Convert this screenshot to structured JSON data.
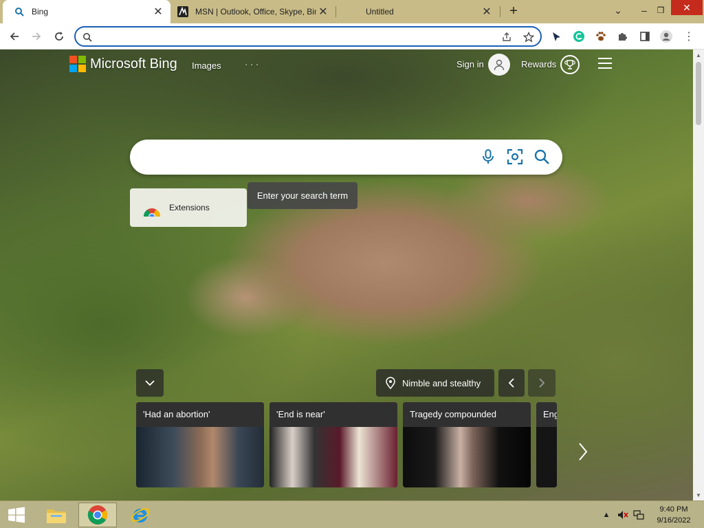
{
  "tabs": [
    {
      "title": "Bing",
      "active": true
    },
    {
      "title": "MSN | Outlook, Office, Skype, Bing, Breaking News, and Latest Videos",
      "active": false
    },
    {
      "title": "Untitled",
      "active": false
    }
  ],
  "address_bar": {
    "value": "",
    "placeholder": ""
  },
  "header": {
    "logo_text": "Microsoft Bing",
    "nav_images": "Images",
    "nav_more": "· · ·",
    "sign_in": "Sign in",
    "rewards": "Rewards"
  },
  "search": {
    "value": "",
    "placeholder": ""
  },
  "extension_card": {
    "label": "Extensions"
  },
  "tooltip": {
    "text": "Enter your search term"
  },
  "image_caption": {
    "text": "Nimble and stealthy"
  },
  "news": [
    {
      "headline": "'Had an abortion'"
    },
    {
      "headline": "'End is near'"
    },
    {
      "headline": "Tragedy compounded"
    },
    {
      "headline": "Eng"
    }
  ],
  "taskbar": {
    "time": "9:40 PM",
    "date": "9/16/2022"
  },
  "colors": {
    "ms_red": "#f25022",
    "ms_green": "#7fba00",
    "ms_blue": "#00a4ef",
    "ms_yellow": "#ffb900",
    "bing_blue": "#1a73a8",
    "omnibox_focus": "#1a5fb4",
    "close_red": "#c42b1c"
  }
}
